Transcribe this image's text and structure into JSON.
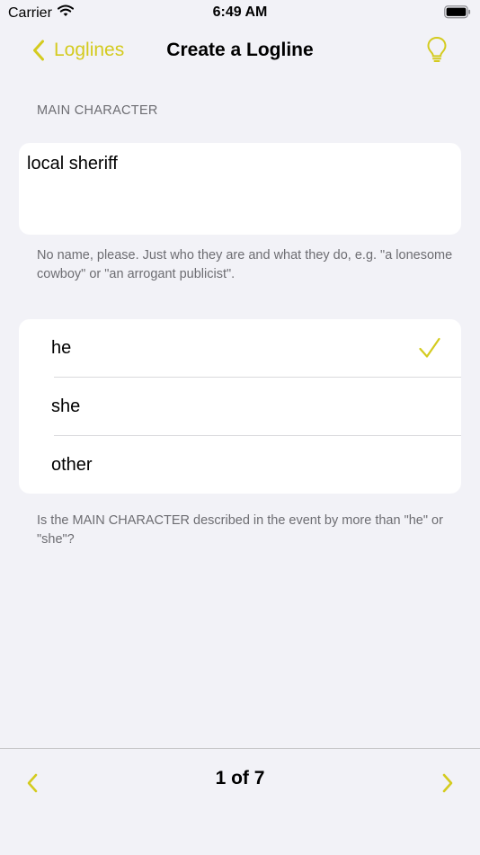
{
  "status_bar": {
    "carrier": "Carrier",
    "time": "6:49 AM"
  },
  "nav": {
    "back_label": "Loglines",
    "title": "Create a Logline",
    "back_icon": "chevron-left-icon",
    "tips_icon": "lightbulb-icon"
  },
  "main_character": {
    "section_header": "MAIN CHARACTER",
    "value": "local sheriff",
    "note": "No name, please. Just who they are and what they do, e.g. \"a lonesome cowboy\" or \"an arrogant publicist\"."
  },
  "pronouns": {
    "options": [
      {
        "label": "he",
        "selected": true
      },
      {
        "label": "she",
        "selected": false
      },
      {
        "label": "other",
        "selected": false
      }
    ],
    "note": "Is the MAIN CHARACTER described in the event by more than \"he\" or \"she\"?"
  },
  "toolbar": {
    "page_indicator": "1 of 7",
    "prev_icon": "chevron-left-icon",
    "next_icon": "chevron-right-icon"
  },
  "colors": {
    "accent": "#D4CB1F",
    "background": "#F2F2F7",
    "card": "#FFFFFF",
    "secondary_text": "#6D6D72"
  }
}
